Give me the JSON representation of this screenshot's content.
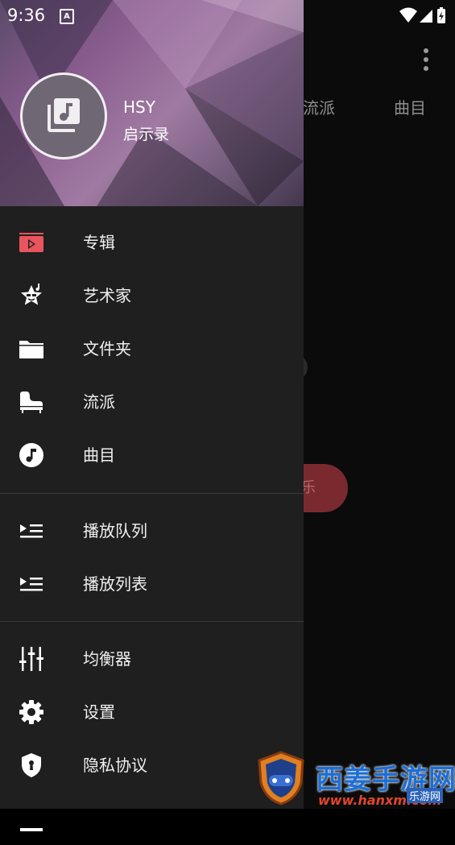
{
  "status_bar": {
    "time": "9:36",
    "notification_glyph": "A"
  },
  "background_app": {
    "tabs": [
      {
        "label": "流派"
      },
      {
        "label": "曲目"
      }
    ],
    "button_label": "乐"
  },
  "drawer": {
    "header": {
      "name": "HSY",
      "subtitle": "启示录"
    },
    "sections": [
      {
        "items": [
          {
            "label": "专辑",
            "icon": "album-icon"
          },
          {
            "label": "艺术家",
            "icon": "artist-star-icon"
          },
          {
            "label": "文件夹",
            "icon": "folder-icon"
          },
          {
            "label": "流派",
            "icon": "piano-icon"
          },
          {
            "label": "曲目",
            "icon": "music-note-icon"
          }
        ]
      },
      {
        "items": [
          {
            "label": "播放队列",
            "icon": "queue-icon"
          },
          {
            "label": "播放列表",
            "icon": "playlist-icon"
          }
        ]
      },
      {
        "items": [
          {
            "label": "均衡器",
            "icon": "equalizer-icon"
          },
          {
            "label": "设置",
            "icon": "settings-gear-icon"
          },
          {
            "label": "隐私协议",
            "icon": "privacy-shield-icon"
          }
        ]
      }
    ],
    "accent_color": "#e8555c"
  },
  "watermark": {
    "title": "西姜手游网",
    "url": "www.hanxm.com",
    "sub": "乐游网"
  }
}
